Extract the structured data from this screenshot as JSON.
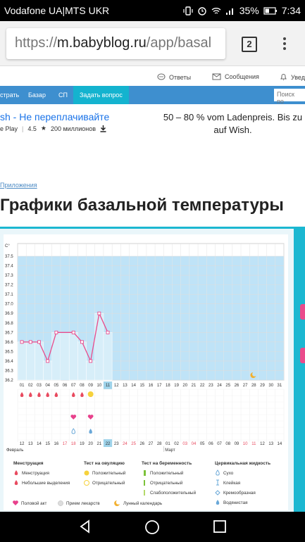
{
  "statusbar": {
    "carrier": "Vodafone UA|MTS UKR",
    "battery": "35%",
    "time": "7:34"
  },
  "browser": {
    "url_scheme": "https://",
    "url_host": "m.babyblog.ru",
    "url_path": "/app/basal",
    "tab_count": "2"
  },
  "topnav": {
    "answers": "Ответы",
    "messages": "Сообщения",
    "notifications": "Увед"
  },
  "menubar": {
    "items": [
      "страть",
      "Базар",
      "СП"
    ],
    "ask": "Задать вопрос",
    "search_placeholder": "Поиск по"
  },
  "ad": {
    "title": "sh - Не переплачивайте",
    "store": "e Play",
    "rating": "4.5",
    "installs": "200 миллионов",
    "right_text": "50 – 80 % vom Ladenpreis. Bis zu auf Wish."
  },
  "breadcrumb": "Приложения",
  "page_title": "Графики базальной температуры",
  "chart_data": {
    "type": "line",
    "ylabel": "C°",
    "ylim": [
      36.2,
      37.5
    ],
    "yticks": [
      "37.5",
      "37.4",
      "37.3",
      "37.2",
      "37.1",
      "37.0",
      "36.9",
      "36.8",
      "36.7",
      "36.6",
      "36.5",
      "36.4",
      "36.3",
      "36.2"
    ],
    "days": [
      "01",
      "02",
      "03",
      "04",
      "05",
      "06",
      "07",
      "08",
      "09",
      "10",
      "11",
      "12",
      "13",
      "14",
      "15",
      "16",
      "17",
      "18",
      "19",
      "20",
      "21",
      "22",
      "23",
      "24",
      "25",
      "26",
      "27",
      "28",
      "29",
      "30",
      "31"
    ],
    "today_index": 10,
    "bars": [
      36.6,
      36.6,
      36.6,
      36.4,
      36.7,
      null,
      36.7,
      36.6,
      36.4,
      36.9,
      36.7
    ],
    "line": [
      {
        "day": 1,
        "value": 36.6
      },
      {
        "day": 2,
        "value": 36.6
      },
      {
        "day": 3,
        "value": 36.6
      },
      {
        "day": 4,
        "value": 36.4
      },
      {
        "day": 5,
        "value": 36.7
      },
      {
        "day": 7,
        "value": 36.7
      },
      {
        "day": 8,
        "value": 36.6
      },
      {
        "day": 9,
        "value": 36.4
      },
      {
        "day": 10,
        "value": 36.9
      },
      {
        "day": 11,
        "value": 36.7
      }
    ],
    "moon_day": 28,
    "bottom_dates": [
      "12",
      "13",
      "14",
      "15",
      "16",
      "17",
      "18",
      "19",
      "20",
      "21",
      "22",
      "23",
      "24",
      "25",
      "26",
      "27",
      "28",
      "01",
      "02",
      "03",
      "04",
      "05",
      "06",
      "07",
      "08",
      "09",
      "10",
      "11",
      "12",
      "13",
      "14"
    ],
    "bottom_red": [
      "17",
      "18",
      "24",
      "25",
      "03",
      "04",
      "10",
      "11"
    ],
    "bottom_today": "22",
    "month_left": "Февраль",
    "month_right": "Март",
    "menstruation_drops": [
      1,
      2,
      3,
      4,
      5,
      7,
      9
    ],
    "light_drop_day": 8,
    "intercourse_days": [
      7,
      9
    ],
    "ovulation_positive_day": 9,
    "fluid_days": [
      7,
      9
    ]
  },
  "legend": {
    "col1": {
      "title": "Менструация",
      "items": [
        "Менструация",
        "Небольшие выделения"
      ]
    },
    "col2": {
      "title": "Тест на овуляцию",
      "items": [
        "Положительный",
        "Отрицательный"
      ]
    },
    "col3": {
      "title": "Тест на беременность",
      "items": [
        "Положительный",
        "Отрицательный",
        "Слабоположительный"
      ]
    },
    "col4": {
      "title": "Цервикальная жидкость",
      "items": [
        "Сухо",
        "Клейкая",
        "Кремообразная",
        "Водянистая",
        "Яичный белок"
      ]
    },
    "bottom": [
      "Половой акт",
      "Прием лекарств",
      "Лунный календарь"
    ]
  },
  "colors": {
    "accent": "#3e8fcf",
    "teal": "#1bb7d1",
    "chart_fill": "#bfe3f7",
    "line": "#ea4b8b",
    "red": "#e84a5f"
  }
}
